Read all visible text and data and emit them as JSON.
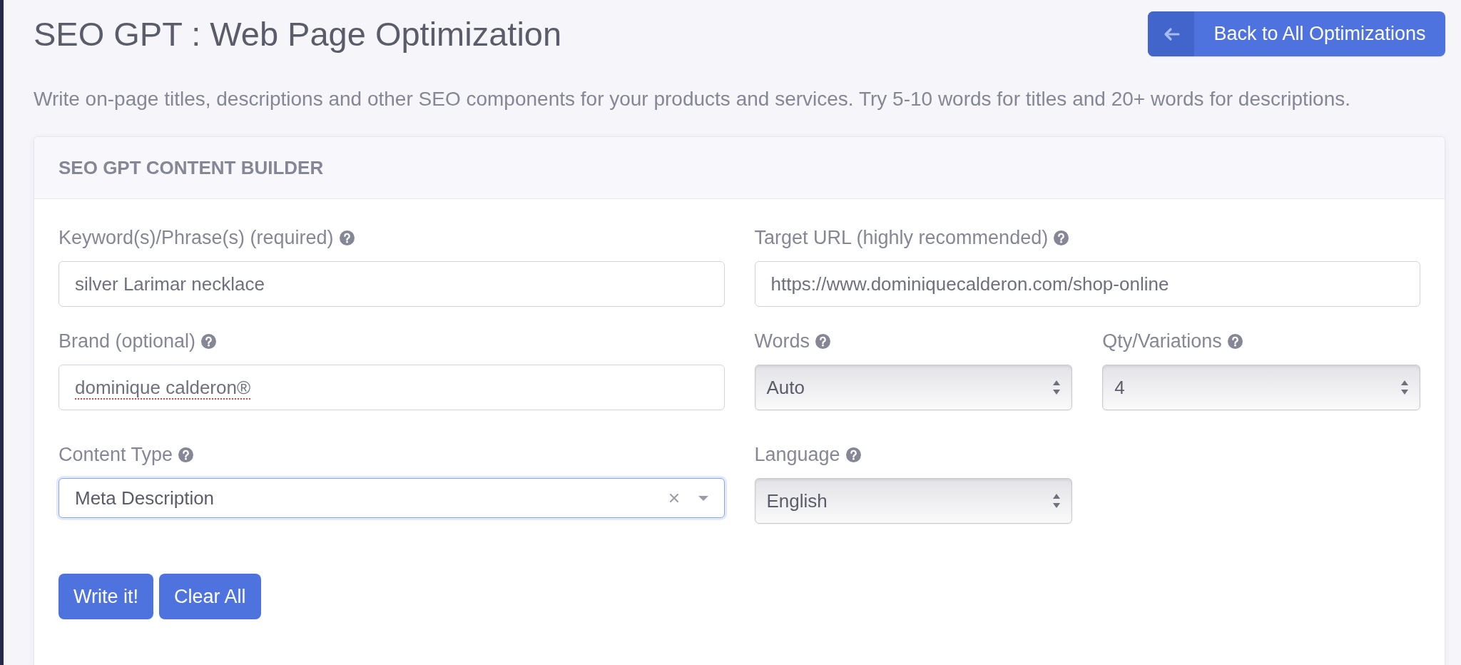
{
  "header": {
    "title": "SEO GPT : Web Page Optimization",
    "back_button": {
      "label": "Back to All Optimizations"
    }
  },
  "description": "Write on-page titles, descriptions and other SEO components for your products and services. Try 5-10 words for titles and 20+ words for descriptions.",
  "card": {
    "title": "SEO GPT CONTENT BUILDER",
    "rows": [
      {
        "left": {
          "kind": "text",
          "label": "Keyword(s)/Phrase(s) (required)",
          "help": true,
          "value": "silver Larimar necklace",
          "focused": false,
          "spellcheck_flagged": false
        },
        "right": [
          {
            "kind": "text",
            "label": "Target URL (highly recommended)",
            "help": true,
            "value": "https://www.dominiquecalderon.com/shop-online",
            "focused": false,
            "spellcheck_flagged": false
          }
        ]
      },
      {
        "left": {
          "kind": "text",
          "label": "Brand (optional)",
          "help": true,
          "value": "dominique calderon®",
          "focused": false,
          "spellcheck_flagged": true
        },
        "right": [
          {
            "kind": "select",
            "label": "Words",
            "help": true,
            "value": "Auto",
            "focused": false,
            "spellcheck_flagged": false
          },
          {
            "kind": "select",
            "label": "Qty/Variations",
            "help": true,
            "value": "4",
            "focused": false,
            "spellcheck_flagged": false
          }
        ]
      },
      {
        "left": {
          "kind": "combo",
          "label": "Content Type",
          "help": true,
          "value": "Meta Description",
          "focused": true,
          "spellcheck_flagged": false
        },
        "right": [
          {
            "kind": "select",
            "label": "Language",
            "help": true,
            "value": "English",
            "focused": false,
            "spellcheck_flagged": false
          }
        ]
      }
    ],
    "buttons": [
      {
        "label": "Write it!"
      },
      {
        "label": "Clear All"
      }
    ]
  }
}
